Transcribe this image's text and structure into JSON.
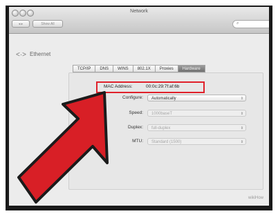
{
  "window": {
    "title": "Network"
  },
  "toolbar": {
    "back_label": "◂ ▸",
    "show_all_label": "Show All",
    "search_placeholder": ""
  },
  "service": {
    "name": "Ethernet"
  },
  "tabs": [
    {
      "label": "TCP/IP",
      "selected": false
    },
    {
      "label": "DNS",
      "selected": false
    },
    {
      "label": "WINS",
      "selected": false
    },
    {
      "label": "802.1X",
      "selected": false
    },
    {
      "label": "Proxies",
      "selected": false
    },
    {
      "label": "Hardware",
      "selected": true
    }
  ],
  "hardware": {
    "mac_label": "MAC Address:",
    "mac_value": "00:0c:29:7f:af:6b",
    "fields": [
      {
        "label": "Configure:",
        "value": "Automatically",
        "enabled": true
      },
      {
        "label": "Speed:",
        "value": "1000baseT",
        "enabled": false
      },
      {
        "label": "Duplex:",
        "value": "full-duplex",
        "enabled": false
      },
      {
        "label": "MTU:",
        "value": "Standard (1500)",
        "enabled": false
      }
    ]
  },
  "annotation": {
    "highlight_color": "#e0202a",
    "arrow_color": "#d81f26"
  },
  "watermark": "wikiHow"
}
